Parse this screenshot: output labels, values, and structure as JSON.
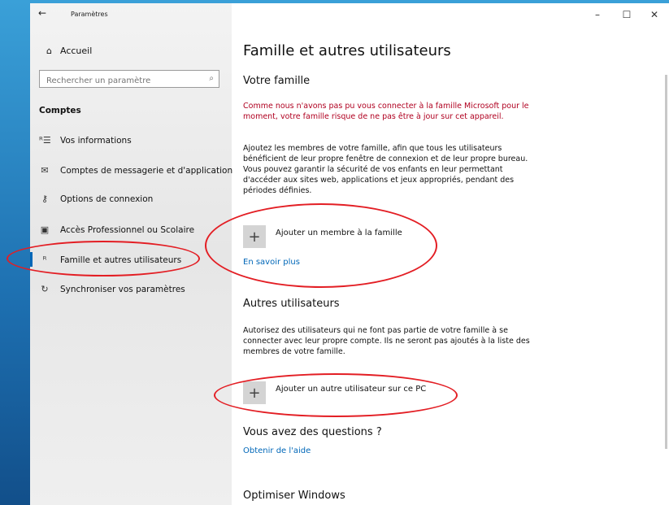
{
  "window": {
    "title": "Paramètres",
    "back_glyph": "←",
    "controls": {
      "minimize": "–",
      "maximize": "☐",
      "close": "✕"
    }
  },
  "sidebar": {
    "home": {
      "icon": "home-icon",
      "glyph": "⌂",
      "label": "Accueil"
    },
    "search": {
      "placeholder": "Rechercher un paramètre",
      "icon": "search-icon",
      "glyph": "⌕"
    },
    "section_title": "Comptes",
    "items": [
      {
        "icon": "person-info-icon",
        "glyph": "ᴿ☰",
        "label": "Vos informations"
      },
      {
        "icon": "mail-icon",
        "glyph": "✉",
        "label": "Comptes de messagerie et d'application"
      },
      {
        "icon": "key-icon",
        "glyph": "⚷",
        "label": "Options de connexion"
      },
      {
        "icon": "briefcase-icon",
        "glyph": "▣",
        "label": "Accès Professionnel ou Scolaire"
      },
      {
        "icon": "family-icon",
        "glyph": "ᴿ",
        "label": "Famille et autres utilisateurs"
      },
      {
        "icon": "sync-icon",
        "glyph": "↻",
        "label": "Synchroniser vos paramètres"
      }
    ]
  },
  "main": {
    "title": "Famille et autres utilisateurs",
    "family": {
      "heading": "Votre famille",
      "warning": "Comme nous n'avons pas pu vous connecter à la famille Microsoft pour le moment, votre famille risque de ne pas être à jour sur cet appareil.",
      "description": "Ajoutez les membres de votre famille, afin que tous les utilisateurs bénéficient de leur propre fenêtre de connexion et de leur propre bureau. Vous pouvez garantir la sécurité de vos enfants en leur permettant d'accéder aux sites web, applications et jeux appropriés, pendant des périodes définies.",
      "add_label": "Ajouter un membre à la famille",
      "learn_more": "En savoir plus"
    },
    "others": {
      "heading": "Autres utilisateurs",
      "description": "Autorisez des utilisateurs qui ne font pas partie de votre famille à se connecter avec leur propre compte. Ils ne seront pas ajoutés à la liste des membres de votre famille.",
      "add_label": "Ajouter un autre utilisateur sur ce PC"
    },
    "questions": {
      "heading": "Vous avez des questions ?",
      "link": "Obtenir de l'aide"
    },
    "optimize": {
      "heading": "Optimiser Windows"
    },
    "plus_glyph": "+"
  },
  "annotation_color": "#e31e24",
  "accent_color": "#0067b8"
}
